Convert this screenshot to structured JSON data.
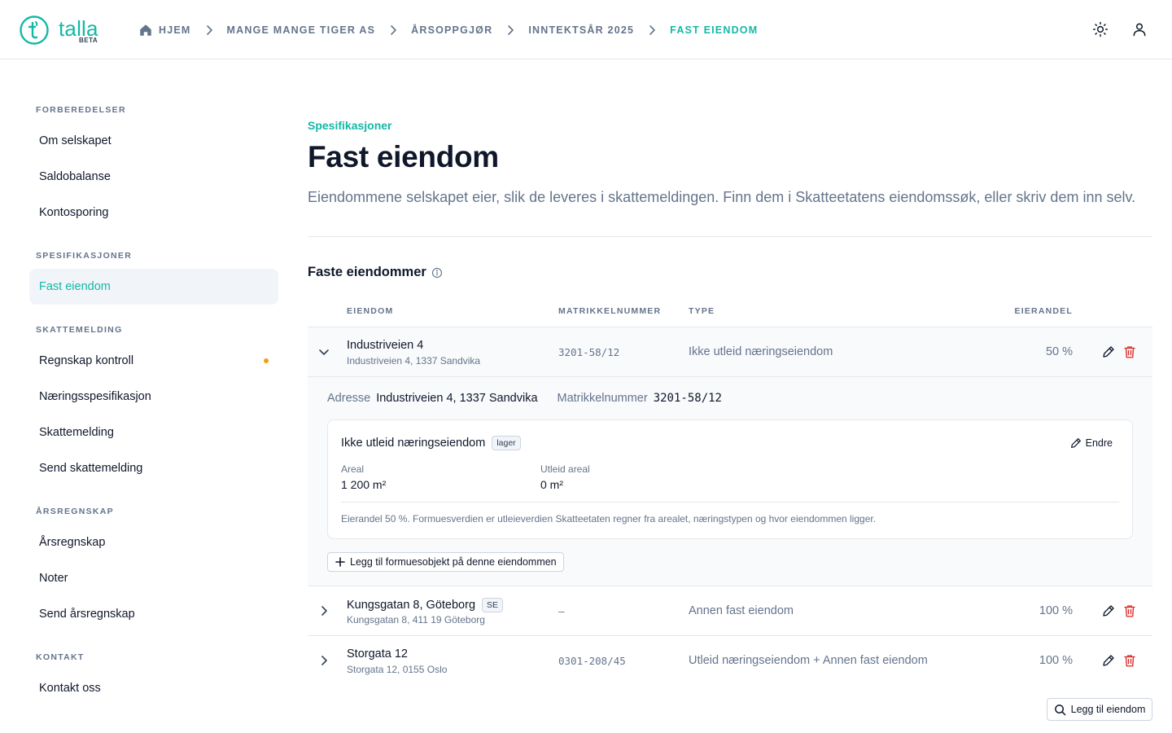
{
  "brand": {
    "name": "talla",
    "badge": "BETA",
    "color": "#14b8a6"
  },
  "breadcrumb": [
    {
      "label": "HJEM",
      "icon": "home-icon"
    },
    {
      "label": "MANGE MANGE TIGER AS"
    },
    {
      "label": "ÅRSOPPGJØR"
    },
    {
      "label": "INNTEKTSÅR 2025"
    },
    {
      "label": "FAST EIENDOM",
      "active": true
    }
  ],
  "header_actions": [
    {
      "icon": "sun-icon"
    },
    {
      "icon": "user-icon"
    }
  ],
  "sidebar": {
    "sections": [
      {
        "title": "FORBEREDELSER",
        "items": [
          "Om selskapet",
          "Saldobalanse",
          "Kontosporing"
        ]
      },
      {
        "title": "SPESIFIKASJONER",
        "items": [
          "Fast eiendom"
        ]
      },
      {
        "title": "SKATTEMELDING",
        "items": [
          "Regnskap kontroll",
          "Næringsspesifikasjon",
          "Skattemelding",
          "Send skattemelding"
        ]
      },
      {
        "title": "ÅRSREGNSKAP",
        "items": [
          "Årsregnskap",
          "Noter",
          "Send årsregnskap"
        ]
      },
      {
        "title": "KONTAKT",
        "items": [
          "Kontakt oss"
        ]
      }
    ],
    "active_item": "Fast eiendom",
    "attention_item": "Regnskap kontroll",
    "attention_color": "#f59e0b"
  },
  "page": {
    "eyebrow": "Spesifikasjoner",
    "title": "Fast eiendom",
    "description": "Eiendommene selskapet eier, slik de leveres i skattemeldingen. Finn dem i Skatteetatens eiendomssøk, eller skriv dem inn selv."
  },
  "properties_section": {
    "title": "Faste eiendommer",
    "columns": [
      "EIENDOM",
      "MATRIKKELNUMMER",
      "TYPE",
      "EIERANDEL"
    ],
    "rows": [
      {
        "name": "Industriveien 4",
        "address": "Industriveien 4, 1337 Sandvika",
        "matrikkel": "3201-58/12",
        "type": "Ikke utleid næringseiendom",
        "share": "50 %",
        "expanded": true
      },
      {
        "name": "Kungsgatan 8, Göteborg",
        "tag": "SE",
        "address": "Kungsgatan 8, 411 19 Göteborg",
        "matrikkel": "–",
        "type": "Annen fast eiendom",
        "share": "100 %"
      },
      {
        "name": "Storgata 12",
        "address": "Storgata 12, 0155 Oslo",
        "matrikkel": "0301-208/45",
        "type": "Utleid næringseiendom + Annen fast eiendom",
        "share": "100 %"
      }
    ]
  },
  "detail": {
    "address_label": "Adresse",
    "address_value": "Industriveien 4, 1337 Sandvika",
    "matrikkel_label": "Matrikkelnummer",
    "matrikkel_value": "3201-58/12",
    "card": {
      "title": "Ikke utleid næringseiendom",
      "tag": "lager",
      "edit_label": "Endre",
      "fields": [
        {
          "label": "Areal",
          "value": "1 200 m²"
        },
        {
          "label": "Utleid areal",
          "value": "0 m²"
        }
      ],
      "note": "Eierandel 50 %. Formuesverdien er utleieverdien Skatteetaten regner fra arealet, næringstypen og hvor eiendommen ligger."
    },
    "add_object_label": "Legg til formuesobjekt på denne eiendommen"
  },
  "add_property_label": "Legg til eiendom"
}
